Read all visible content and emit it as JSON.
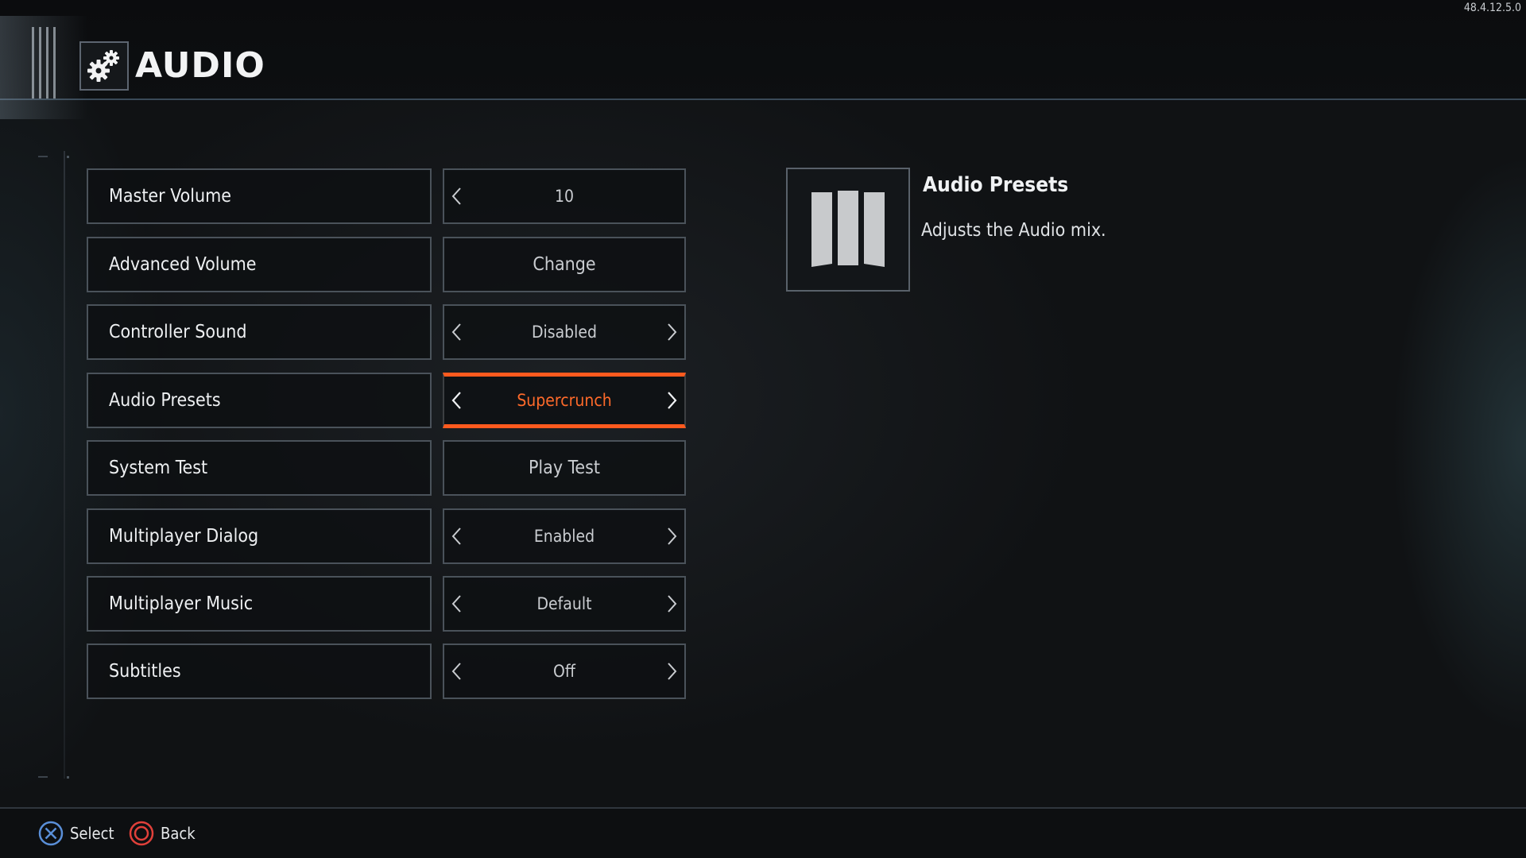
{
  "header": {
    "title": "AUDIO",
    "icon": "gears-icon",
    "version": "48.4.12.5.0"
  },
  "settings": {
    "rows": [
      {
        "label": "Master Volume",
        "value": "10",
        "control": "stepper",
        "left_arrow": true,
        "right_arrow": false
      },
      {
        "label": "Advanced Volume",
        "value": "Change",
        "control": "button",
        "left_arrow": false,
        "right_arrow": false
      },
      {
        "label": "Controller Sound",
        "value": "Disabled",
        "control": "stepper",
        "left_arrow": true,
        "right_arrow": true
      },
      {
        "label": "Audio Presets",
        "value": "Supercrunch",
        "control": "stepper",
        "left_arrow": true,
        "right_arrow": true,
        "selected": true
      },
      {
        "label": "System Test",
        "value": "Play Test",
        "control": "button",
        "left_arrow": false,
        "right_arrow": false
      },
      {
        "label": "Multiplayer Dialog",
        "value": "Enabled",
        "control": "stepper",
        "left_arrow": true,
        "right_arrow": true
      },
      {
        "label": "Multiplayer Music",
        "value": "Default",
        "control": "stepper",
        "left_arrow": true,
        "right_arrow": true
      },
      {
        "label": "Subtitles",
        "value": "Off",
        "control": "stepper",
        "left_arrow": true,
        "right_arrow": true
      }
    ]
  },
  "info_panel": {
    "icon": "black-ops-iii-logo-icon",
    "title": "Audio Presets",
    "description": "Adjusts the Audio mix."
  },
  "footer": {
    "select_label": "Select",
    "select_icon": "cross-button-icon",
    "back_label": "Back",
    "back_icon": "circle-button-icon"
  },
  "colors": {
    "accent": "#ff5a1e",
    "cross_button": "#5a8fd8",
    "circle_button": "#e0403a",
    "border": "#4a525a"
  }
}
